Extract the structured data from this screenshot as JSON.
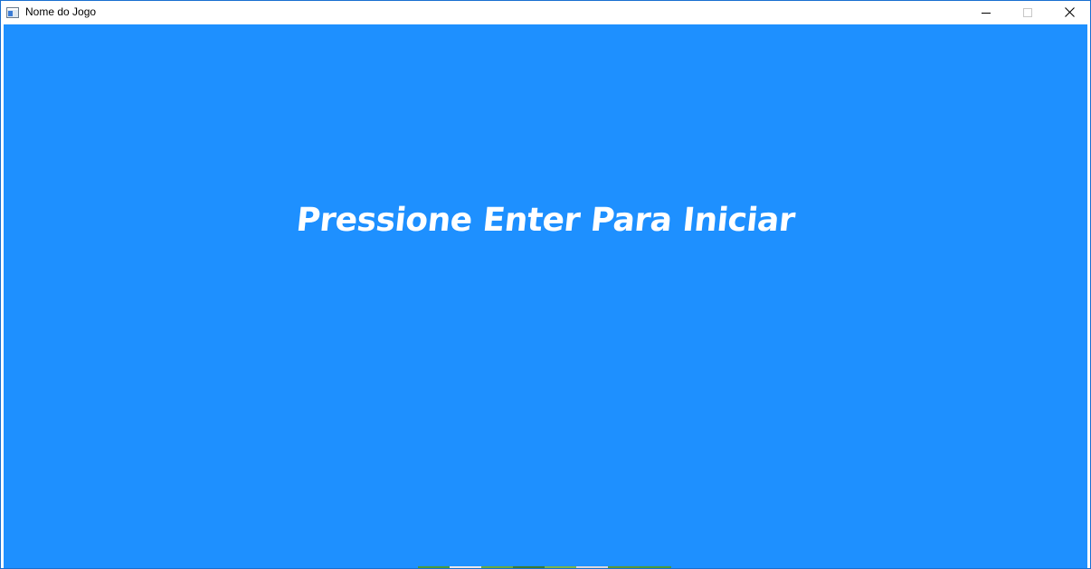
{
  "window": {
    "title": "Nome do Jogo",
    "icon": "app-window-icon",
    "controls": [
      "minimize-icon",
      "maximize-icon",
      "close-icon"
    ]
  },
  "game": {
    "background_color": "#1e90ff",
    "prompt_text": "Pressione Enter Para Iniciar",
    "prompt_color": "#ffffff"
  }
}
